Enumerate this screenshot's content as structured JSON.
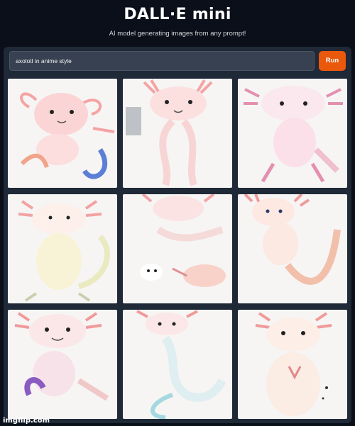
{
  "app": {
    "title": "DALL·E mini",
    "subtitle": "AI model generating images from any prompt!"
  },
  "prompt": {
    "value": "axolotl in anime style",
    "run_label": "Run"
  },
  "gallery": {
    "image_count": 9,
    "subject": "axolotl"
  },
  "watermark": "imgflip.com",
  "colors": {
    "background": "#0b0f19",
    "panel": "#1f2937",
    "input": "#374151",
    "run_button": "#ea580c"
  }
}
